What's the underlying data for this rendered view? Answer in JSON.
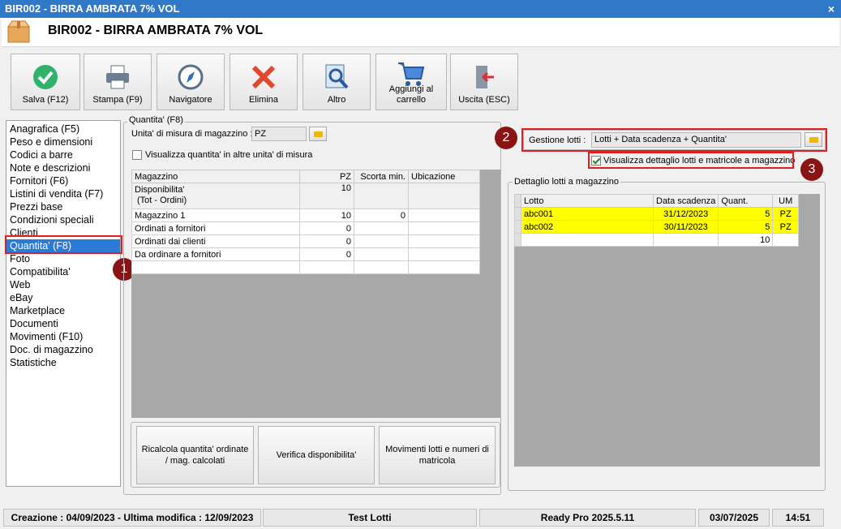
{
  "window": {
    "title": "BIR002 - BIRRA AMBRATA 7% VOL",
    "close_glyph": "×"
  },
  "header": {
    "title": "BIR002 - BIRRA AMBRATA 7% VOL",
    "icon": "package-icon"
  },
  "toolbar": [
    {
      "label": "Salva (F12)",
      "icon": "check-circle-icon"
    },
    {
      "label": "Stampa (F9)",
      "icon": "printer-icon"
    },
    {
      "label": "Navigatore",
      "icon": "compass-icon"
    },
    {
      "label": "Elimina",
      "icon": "delete-x-icon"
    },
    {
      "label": "Altro",
      "icon": "magnifier-icon"
    },
    {
      "label": "Aggiungi al carrello",
      "icon": "cart-icon"
    },
    {
      "label": "Uscita (ESC)",
      "icon": "exit-door-icon"
    }
  ],
  "menu": [
    "Anagrafica (F5)",
    "Peso e dimensioni",
    "Codici a barre",
    "Note e descrizioni",
    "Fornitori (F6)",
    "Listini di vendita (F7)",
    "Prezzi base",
    "Condizioni speciali",
    "Clienti",
    "Quantita' (F8)",
    "Foto",
    "Compatibilita'",
    "Web",
    "eBay",
    "Marketplace",
    "Documenti",
    "Movimenti (F10)",
    "Doc. di magazzino",
    "Statistiche"
  ],
  "menu_selected": 9,
  "badges": [
    "1",
    "2",
    "3"
  ],
  "quantity": {
    "group_label": "Quantita' (F8)",
    "um_label": "Unita' di misura di magazzino :",
    "um_value": "PZ",
    "show_other_units_label": "Visualizza quantita' in altre unita' di misura",
    "show_other_units_checked": false,
    "table": {
      "headers": [
        "Magazzino",
        "PZ",
        "Scorta min.",
        "Ubicazione"
      ],
      "rows": [
        [
          "Disponibilita' (Tot - Ordini)",
          "10",
          "",
          ""
        ],
        [
          "Magazzino 1",
          "10",
          "0",
          ""
        ],
        [
          "Ordinati a fornitori",
          "0",
          "",
          ""
        ],
        [
          "Ordinati dai clienti",
          "0",
          "",
          ""
        ],
        [
          "Da ordinare a fornitori",
          "0",
          "",
          ""
        ]
      ]
    },
    "disp_line1": "Disponibilita'",
    "disp_line2": "(Tot - Ordini)",
    "buttons": [
      "Ricalcola quantita' ordinate / mag. calcolati",
      "Verifica disponibilita'",
      "Movimenti lotti e numeri di matricola"
    ]
  },
  "lots": {
    "gestione_label": "Gestione lotti :",
    "gestione_value": "Lotti + Data scadenza + Quantita'",
    "show_detail_label": "Visualizza dettaglio lotti e matricole a magazzino",
    "show_detail_checked": true,
    "group_label": "Dettaglio lotti a magazzino",
    "headers": [
      "Lotto",
      "Data scadenza",
      "Quant.",
      "UM"
    ],
    "rows": [
      [
        "abc001",
        "31/12/2023",
        "5",
        "PZ"
      ],
      [
        "abc002",
        "30/11/2023",
        "5",
        "PZ"
      ]
    ],
    "total": "10",
    "highlight_color": "#ffff00"
  },
  "status": {
    "dates": "Creazione : 04/09/2023 - Ultima modifica : 12/09/2023",
    "company": "Test Lotti",
    "version": "Ready Pro 2025.5.11",
    "date": "03/07/2025",
    "time": "14:51"
  },
  "colors": {
    "title_bar": "#3078c8",
    "selection": "#2a7ad8",
    "annotation": "#e02020",
    "badge": "#8a1414"
  }
}
